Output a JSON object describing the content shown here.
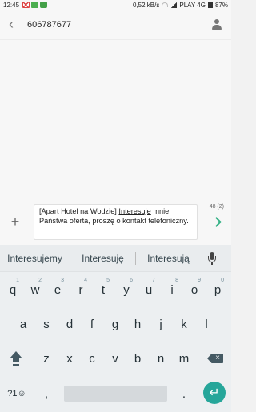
{
  "status_bar": {
    "time": "12:45",
    "notification_icons": [
      "gmail-icon",
      "battery-saver-icon",
      "android-app-icon"
    ],
    "network_speed": "0,52 kB/s",
    "carrier": "PLAY 4G",
    "battery": "87%"
  },
  "header": {
    "contact_number": "606787677",
    "back_icon": "back-arrow-icon",
    "contact_icon": "person-icon"
  },
  "compose": {
    "message_before": "[Apart Hotel na Wodzie] ",
    "message_typed_word": "Interesuje",
    "message_after": " mnie Państwa oferta, proszę o kontakt telefoniczny.",
    "char_count": "48 (2)",
    "attach_icon": "plus-icon",
    "send_icon": "send-arrow-icon"
  },
  "suggestions": [
    "Interesujemy",
    "Interesuję",
    "Interesują"
  ],
  "keyboard": {
    "row1": [
      "q",
      "w",
      "e",
      "r",
      "t",
      "y",
      "u",
      "i",
      "o",
      "p"
    ],
    "row1_hints": [
      "1",
      "2",
      "3",
      "4",
      "5",
      "6",
      "7",
      "8",
      "9",
      "0"
    ],
    "row2": [
      "a",
      "s",
      "d",
      "f",
      "g",
      "h",
      "j",
      "k",
      "l"
    ],
    "row3": [
      "z",
      "x",
      "c",
      "v",
      "b",
      "n",
      "m"
    ],
    "symbols_label": "?1☺",
    "comma": ",",
    "period": ".",
    "enter_glyph": "↵",
    "accent_color": "#26a69a"
  }
}
